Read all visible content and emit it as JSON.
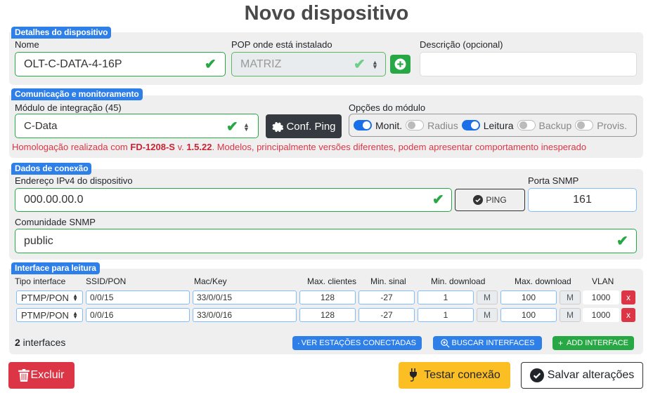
{
  "page": {
    "title": "Novo dispositivo"
  },
  "details": {
    "section_label": "Detalhes do dispositivo",
    "name_label": "Nome",
    "name_value": "OLT-C-DATA-4-16P",
    "pop_label": "POP onde está instalado",
    "pop_value": "MATRIZ",
    "description_label": "Descrição (opcional)",
    "description_value": ""
  },
  "communication": {
    "section_label": "Comunicação e monitoramento",
    "module_label": "Módulo de integração (45)",
    "module_value": "C-Data",
    "conf_ping_label": "Conf. Ping",
    "options_label": "Opções do módulo",
    "toggles": [
      {
        "label": "Monit.",
        "on": true
      },
      {
        "label": "Radius",
        "on": false
      },
      {
        "label": "Leitura",
        "on": true
      },
      {
        "label": "Backup",
        "on": false
      },
      {
        "label": "Provis.",
        "on": false
      }
    ],
    "warning": {
      "prefix": "Homologação realizada com ",
      "model": "FD-1208-S",
      "mid": " v. ",
      "version": "1.5.22",
      "suffix": ". Modelos, principalmente versões diferentes, podem apresentar comportamento inesperado"
    }
  },
  "connection": {
    "section_label": "Dados de conexão",
    "ip_label": "Endereço IPv4 do dispositivo",
    "ip_value": "000.00.00.0",
    "ping_label": "PING",
    "port_label": "Porta SNMP",
    "port_value": "161",
    "community_label": "Comunidade SNMP",
    "community_value": "public"
  },
  "interfaces": {
    "section_label": "Interface para leitura",
    "columns": [
      "Tipo interface",
      "SSID/PON",
      "Mac/Key",
      "Max. clientes",
      "Min. sinal",
      "Min. download",
      "Max. download",
      "VLAN"
    ],
    "unit_label": "M",
    "remove_label": "x",
    "rows": [
      {
        "type": "PTMP/PON",
        "ssid": "0/0/15",
        "mac": "33/0/0/15",
        "max_clients": "128",
        "min_signal": "-27",
        "min_download": "1",
        "max_download": "100",
        "vlan": "1000"
      },
      {
        "type": "PTMP/PON",
        "ssid": "0/0/16",
        "mac": "33/0/0/16",
        "max_clients": "128",
        "min_signal": "-27",
        "min_download": "1",
        "max_download": "100",
        "vlan": "1000"
      }
    ],
    "count": "2",
    "count_suffix": " interfaces",
    "view_stations_label": "VER ESTAÇÕES CONECTADAS",
    "search_interfaces_label": "BUSCAR INTERFACES",
    "add_interface_label": "ADD INTERFACE"
  },
  "footer": {
    "delete_label": "Excluir",
    "test_label": "Testar conexão",
    "save_label": "Salvar alterações"
  },
  "colors": {
    "primary": "#2e7fe8",
    "success": "#28a745",
    "danger": "#dc3545",
    "warning": "#fbbf24",
    "dark": "#343a40"
  }
}
